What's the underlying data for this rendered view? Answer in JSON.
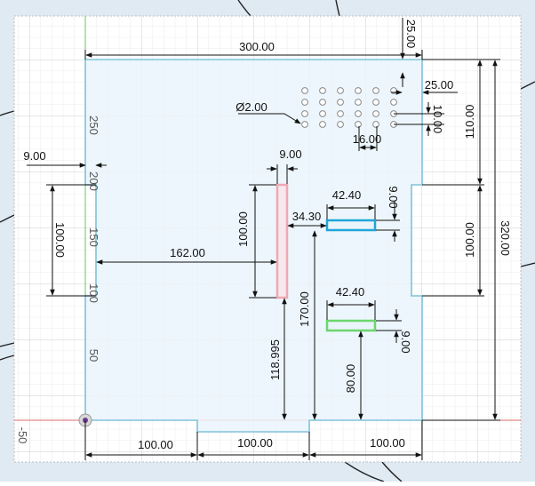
{
  "colors": {
    "background": "#dfeaf3",
    "canvas": "#ffffff",
    "grid_minor": "#e6e6e6",
    "grid_major": "#cfcfcf",
    "profile_stroke": "#7ec3d9",
    "profile_fill": "#eaf4fb",
    "red_axis": "#e06a6a",
    "green_axis": "#6ac36a",
    "slot_pink": "#f0a8b4",
    "slot_blue": "#1fa6d8",
    "slot_green": "#6cd66c",
    "dim_line": "#111111"
  },
  "ruler_ticks": [
    "250",
    "200",
    "150",
    "100",
    "50",
    "-50"
  ],
  "dimensions": {
    "top_width": "300.00",
    "top_offset": "25.00",
    "right_offset": "25.00",
    "hole_diameter": "Ø2.00",
    "hole_spacing_v": "10.00",
    "hole_spacing_h": "16.00",
    "hole_block_height": "110.00",
    "left_notch_depth": "9.00",
    "left_notch_height": "100.00",
    "pink_slot_width": "9.00",
    "pink_slot_height": "100.00",
    "pink_to_left": "162.00",
    "pink_bottom": "118.995",
    "blue_slot_width": "42.40",
    "blue_slot_height": "9.00",
    "blue_gap": "34.30",
    "blue_bottom": "170.00",
    "right_notch_height": "100.00",
    "total_height": "320.00",
    "green_slot_width": "42.40",
    "green_slot_height": "9.00",
    "green_bottom": "80.00",
    "bottom_seg_1": "100.00",
    "bottom_seg_2": "100.00",
    "bottom_seg_3": "100.00"
  }
}
